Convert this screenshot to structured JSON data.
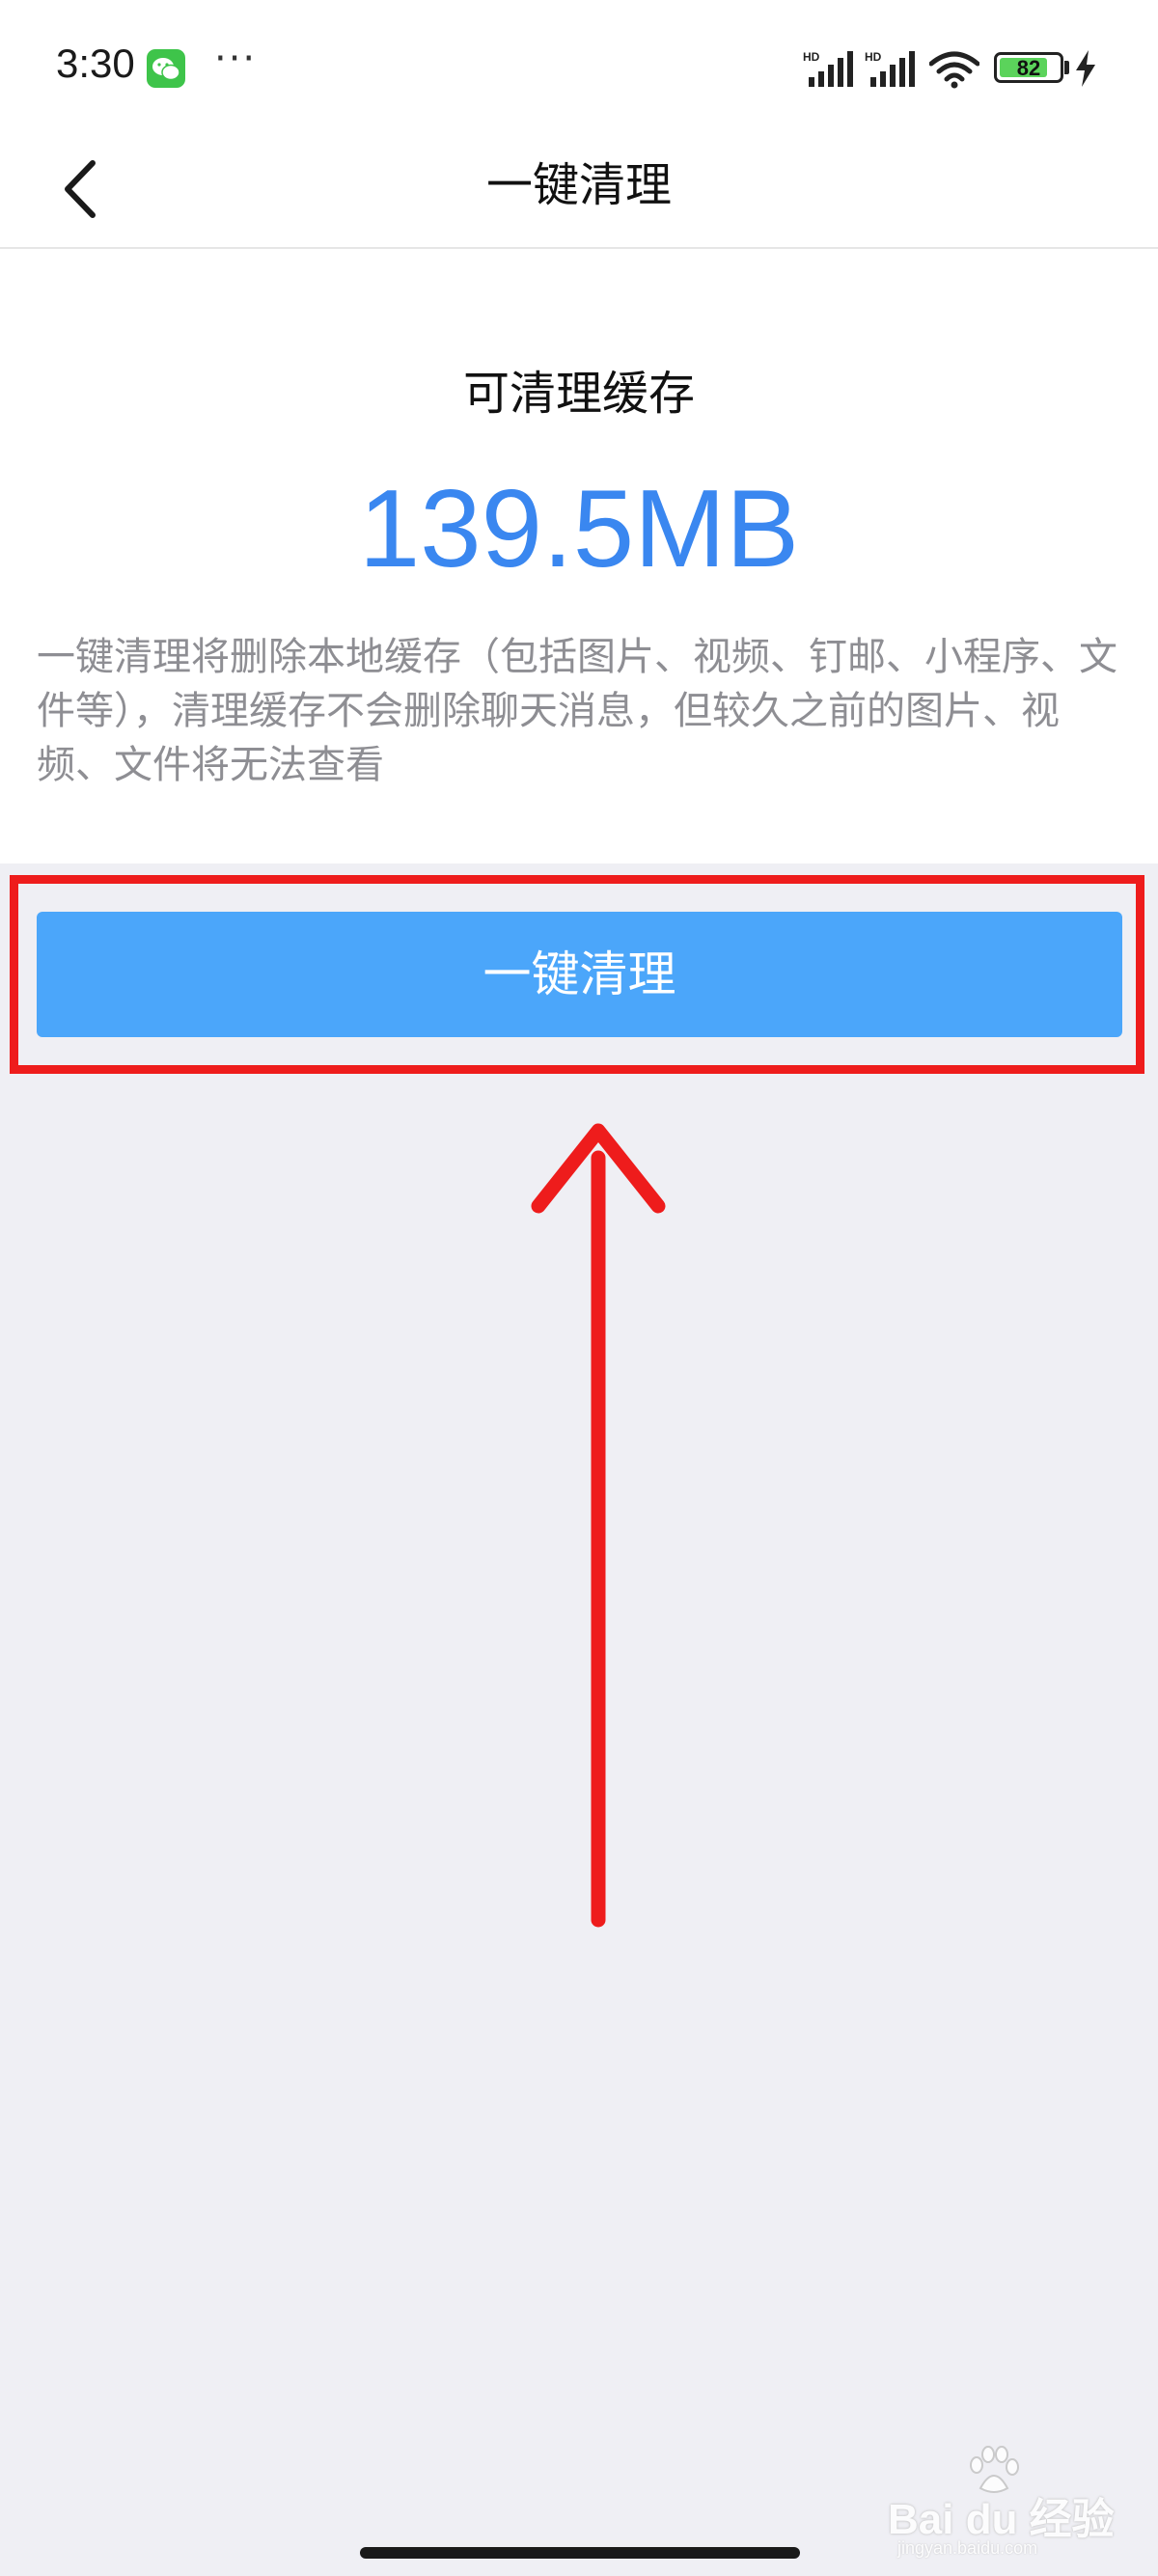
{
  "status_bar": {
    "time": "3:30",
    "more": "···",
    "battery_level": 82,
    "battery_text": "82",
    "network_labels": [
      "HD",
      "HD"
    ]
  },
  "nav": {
    "title": "一键清理",
    "back_icon": "chevron-left-icon"
  },
  "cache": {
    "label": "可清理缓存",
    "size": "139.5MB",
    "description": "一键清理将删除本地缓存（包括图片、视频、钉邮、小程序、文件等），清理缓存不会删除聊天消息，但较久之前的图片、视频、文件将无法查看"
  },
  "action": {
    "button_label": "一键清理"
  },
  "annotation": {
    "highlight_color": "#ee1c1c",
    "arrow_color": "#ee1c1c"
  },
  "watermark": {
    "brand": "Bai du 经验",
    "url": "jingyan.baidu.com"
  },
  "colors": {
    "accent": "#3a87f0",
    "button": "#4ba6fa",
    "background": "#efeff4"
  }
}
